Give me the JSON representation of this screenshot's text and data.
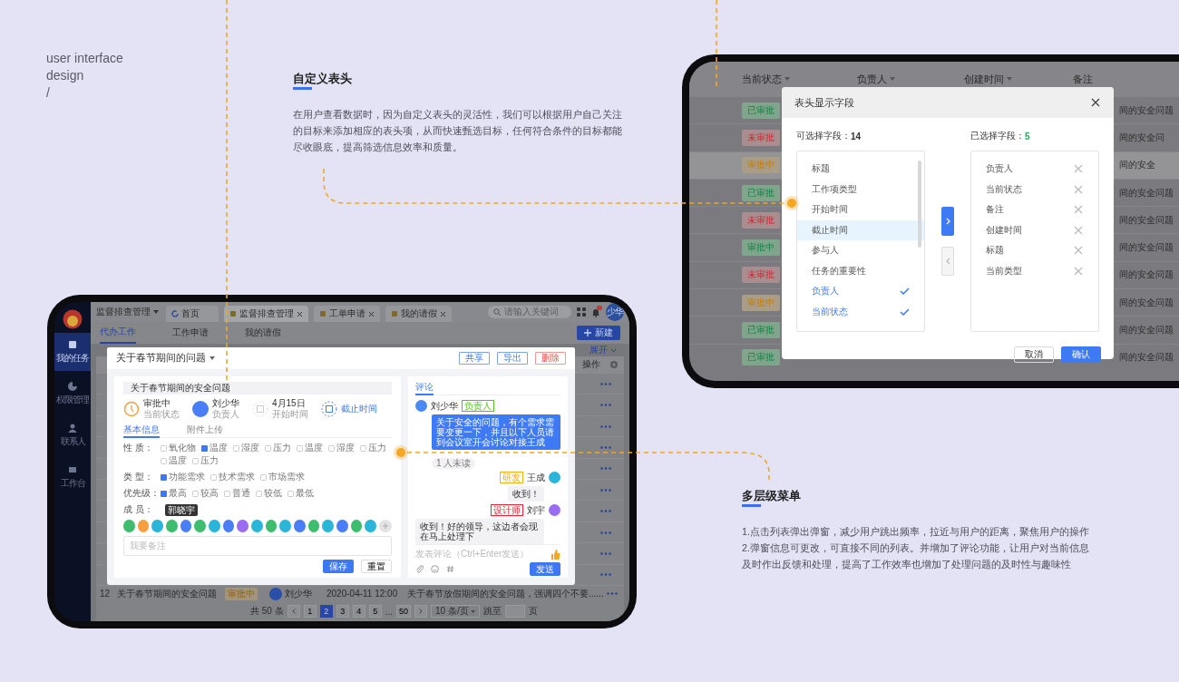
{
  "intro": {
    "lines": [
      "user interface",
      "design",
      "/"
    ]
  },
  "custom_header_note": {
    "title": "自定义表头",
    "text": "在用户查看数据时，因为自定义表头的灵活性，我们可以根据用户自己关注的目标来添加相应的表头项，从而快速甄选目标，任何符合条件的目标都能尽收眼底，提高筛选信息效率和质量。"
  },
  "field_settings_screen": {
    "table": {
      "columns": [
        "当前状态",
        "负责人",
        "创建时间",
        "备注"
      ],
      "rows": [
        {
          "status": "已审批",
          "kind": "approved",
          "remark": "间的安全问题",
          "highlighted": false
        },
        {
          "status": "未审批",
          "kind": "rejected",
          "remark": "间的安全问",
          "highlighted": false
        },
        {
          "status": "审批中",
          "kind": "pending",
          "remark": "间的安全",
          "highlighted": true
        },
        {
          "status": "已审批",
          "kind": "approved",
          "remark": "间的安全问题",
          "highlighted": false
        },
        {
          "status": "未审批",
          "kind": "rejected",
          "remark": "间的安全问题",
          "highlighted": false
        },
        {
          "status": "审批中",
          "kind": "approved",
          "remark": "间的安全问题",
          "highlighted": false
        },
        {
          "status": "未审批",
          "kind": "rejected",
          "remark": "间的安全问题",
          "highlighted": false
        },
        {
          "status": "审批中",
          "kind": "pending",
          "remark": "间的安全问题",
          "highlighted": false
        },
        {
          "status": "已审批",
          "kind": "approved",
          "remark": "间的安全问题",
          "highlighted": false
        },
        {
          "status": "已审批",
          "kind": "approved",
          "remark": "间的安全问题",
          "highlighted": false
        }
      ]
    },
    "dialog": {
      "title": "表头显示字段",
      "available_label": "可选择字段：",
      "available_count": "14",
      "chosen_label": "已选择字段：",
      "chosen_count": "5",
      "available": [
        {
          "label": "标题",
          "checked": false,
          "highlighted": false
        },
        {
          "label": "工作项类型",
          "checked": false,
          "highlighted": false
        },
        {
          "label": "开始时间",
          "checked": false,
          "highlighted": false
        },
        {
          "label": "截止时间",
          "checked": false,
          "highlighted": true
        },
        {
          "label": "参与人",
          "checked": false,
          "highlighted": false
        },
        {
          "label": "任务的重要性",
          "checked": false,
          "highlighted": false
        },
        {
          "label": "负责人",
          "checked": true,
          "highlighted": false
        },
        {
          "label": "当前状态",
          "checked": true,
          "highlighted": false
        }
      ],
      "chosen": [
        "负责人",
        "当前状态",
        "备注",
        "创建时间",
        "标题",
        "当前类型"
      ],
      "move_left_disabled": true,
      "cancel": "取消",
      "confirm": "确认"
    }
  },
  "task_screen": {
    "sidebar": [
      {
        "label": "我的任务",
        "selected": true
      },
      {
        "label": "权限管理",
        "selected": false
      },
      {
        "label": "联系人",
        "selected": false
      },
      {
        "label": "工作台",
        "selected": false
      }
    ],
    "app_menu": "监督排查管理",
    "tabs": [
      {
        "label": "首页",
        "selected": false,
        "closable": false
      },
      {
        "label": "监督排查管理",
        "selected": true,
        "closable": true
      },
      {
        "label": "工单申请",
        "selected": false,
        "closable": true
      },
      {
        "label": "我的请假",
        "selected": false,
        "closable": true
      }
    ],
    "search_placeholder": "请输入关键词",
    "avatar": "少华",
    "subtabs": [
      {
        "label": "代办工作",
        "selected": true
      },
      {
        "label": "工作申请",
        "selected": false
      },
      {
        "label": "我的请假",
        "selected": false
      }
    ],
    "new_button": "新建",
    "expand_link": "展开",
    "action_column": "操作",
    "rows": [
      {
        "kind": "covered"
      },
      {
        "kind": "covered"
      },
      {
        "kind": "covered"
      },
      {
        "kind": "covered"
      },
      {
        "kind": "covered"
      },
      {
        "kind": "covered"
      },
      {
        "kind": "covered"
      },
      {
        "kind": "covered"
      },
      {
        "kind": "covered"
      },
      {
        "kind": "covered"
      },
      {
        "kind": "full",
        "index": "12",
        "title": "关于春节期间的安全问题",
        "status": "审批中",
        "owner": "刘少华",
        "created": "2020-04-11  12:00",
        "remark": "关于春节放假期间的安全问题，强调四个不要......"
      }
    ],
    "pagination": {
      "total": "共 50 条",
      "pages": [
        {
          "label": "1",
          "selected": false
        },
        {
          "label": "2",
          "selected": true
        },
        {
          "label": "3",
          "selected": false
        },
        {
          "label": "4",
          "selected": false
        },
        {
          "label": "5",
          "selected": false
        }
      ],
      "ellipsis": "...",
      "last_page": "50",
      "page_size": "10 条/页",
      "jump_label": "跳至",
      "jump_suffix": "页"
    },
    "detail": {
      "title": "关于春节期间的问题",
      "actions": [
        {
          "label": "共享",
          "kind": "normal"
        },
        {
          "label": "导出",
          "kind": "normal"
        },
        {
          "label": "删除",
          "kind": "danger"
        }
      ],
      "subject": "关于春节期间的安全问题",
      "facts": [
        {
          "kind": "status",
          "value": "审批中",
          "caption": "当前状态"
        },
        {
          "kind": "person",
          "value": "刘少华",
          "caption": "负责人"
        },
        {
          "kind": "date",
          "value": "4月15日",
          "caption": "开始时间"
        },
        {
          "kind": "deadline",
          "value": "截止时间"
        }
      ],
      "tabs": [
        {
          "label": "基本信息",
          "selected": true
        },
        {
          "label": "附件上传",
          "selected": false
        }
      ],
      "fields": [
        {
          "label": "性 质：",
          "options": [
            {
              "label": "氧化物",
              "checked": false
            },
            {
              "label": "温度",
              "checked": true
            },
            {
              "label": "湿度",
              "checked": false
            },
            {
              "label": "压力",
              "checked": false
            },
            {
              "label": "温度",
              "checked": false
            },
            {
              "label": "湿度",
              "checked": false
            },
            {
              "label": "压力",
              "checked": false
            },
            {
              "label": "温度",
              "checked": false
            },
            {
              "label": "压力",
              "checked": false
            }
          ]
        },
        {
          "label": "类 型：",
          "options": [
            {
              "label": "功能需求",
              "checked": true
            },
            {
              "label": "技术需求",
              "checked": false
            },
            {
              "label": "市场需求",
              "checked": false
            }
          ]
        },
        {
          "label": "优先级：",
          "options": [
            {
              "label": "最高",
              "checked": true
            },
            {
              "label": "较高",
              "checked": false
            },
            {
              "label": "普通",
              "checked": false
            },
            {
              "label": "较低",
              "checked": false
            },
            {
              "label": "最低",
              "checked": false
            }
          ]
        }
      ],
      "members_label": "成 员：",
      "member_tooltip": "郭晓宇",
      "members": [
        {
          "color": "#3ebd6e"
        },
        {
          "color": "#f5a040"
        },
        {
          "color": "#2bb5d8"
        },
        {
          "color": "#3ebd6e"
        },
        {
          "color": "#4a7ef5"
        },
        {
          "color": "#3ebd6e"
        },
        {
          "color": "#2bb5d8"
        },
        {
          "color": "#4a7ef5"
        },
        {
          "color": "#9b6cf0"
        },
        {
          "color": "#2bb5d8"
        },
        {
          "color": "#3ebd6e"
        },
        {
          "color": "#2bb5d8"
        },
        {
          "color": "#4a7ef5"
        },
        {
          "color": "#3ebd6e"
        },
        {
          "color": "#2bb5d8"
        },
        {
          "color": "#4a7ef5"
        },
        {
          "color": "#3ebd6e"
        },
        {
          "color": "#2bb5d8"
        }
      ],
      "note_placeholder": "我要备注",
      "save": "保存",
      "reset": "重置",
      "comments": {
        "tab": "评论",
        "messages": [
          {
            "kind": "incoming",
            "author": "刘少华",
            "role": {
              "label": "负责人",
              "color": "#52c41a"
            },
            "avatar": {
              "color": "#4a8af4"
            },
            "text": "关于安全的问题，有个需求需要变更一下，并且以下人员请到会议室开会讨论对接王成"
          },
          {
            "kind": "outgoing",
            "author": "王成",
            "role": {
              "label": "研发",
              "color": "#faad14"
            },
            "avatar": {
              "color": "#2bb5d8"
            },
            "text": "收到！"
          },
          {
            "kind": "outgoing",
            "author": "刘宇",
            "role": {
              "label": "设计师",
              "color": "#f5222d"
            },
            "avatar": {
              "color": "#9b6cf0"
            },
            "text": "收到！好的领导，这边者会现在马上处理下"
          }
        ],
        "unread": "1 人未读",
        "input_placeholder": "发表评论（Ctrl+Enter发送）",
        "send": "发送"
      }
    }
  },
  "multilevel_menu_note": {
    "title": "多层级菜单",
    "items": [
      "1.点击列表弹出弹窗，减少用户跳出频率，拉近与用户的距离，聚焦用户的操作",
      "2.弹窗信息可更改，可直接不同的列表。并增加了评论功能，让用户对当前信息及时作出反馈和处理，提高了工作效率也增加了处理问题的及时性与趣味性"
    ]
  }
}
